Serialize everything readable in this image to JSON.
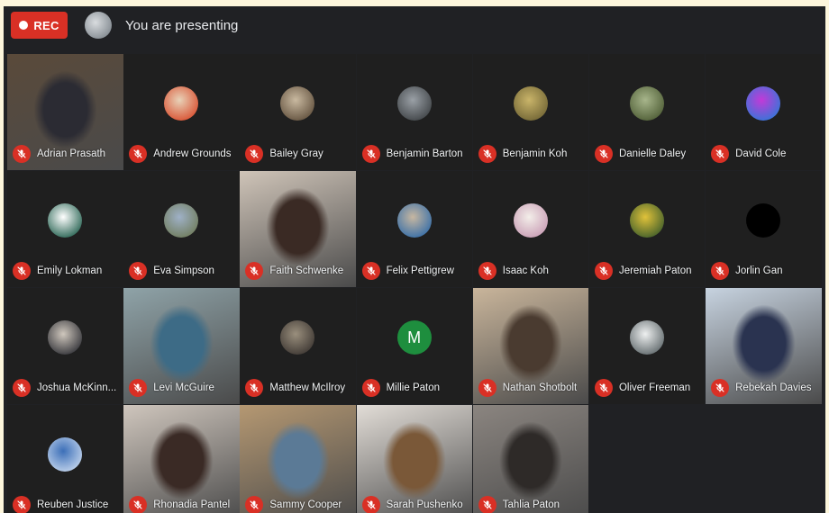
{
  "topbar": {
    "rec_label": "REC",
    "presenting_text": "You are presenting"
  },
  "participants": [
    {
      "name": "Adrian Prasath",
      "video": true,
      "muted": true,
      "avatar_colors": [
        "#5a4a3a",
        "#2b2b33"
      ]
    },
    {
      "name": "Andrew Grounds",
      "video": false,
      "muted": true,
      "avatar_colors": [
        "#e8d2b8",
        "#d84a2a"
      ]
    },
    {
      "name": "Bailey Gray",
      "video": false,
      "muted": true,
      "avatar_colors": [
        "#c9b9a0",
        "#5e4d3a"
      ]
    },
    {
      "name": "Benjamin Barton",
      "video": false,
      "muted": true,
      "avatar_colors": [
        "#9aa0a6",
        "#3c4043"
      ]
    },
    {
      "name": "Benjamin Koh",
      "video": false,
      "muted": true,
      "avatar_colors": [
        "#c9b469",
        "#6e6233"
      ]
    },
    {
      "name": "Danielle Daley",
      "video": false,
      "muted": true,
      "avatar_colors": [
        "#a7b58b",
        "#4b5a32"
      ]
    },
    {
      "name": "David Cole",
      "video": false,
      "muted": true,
      "avatar_colors": [
        "#c23ad8",
        "#2c7ad8"
      ]
    },
    {
      "name": "Emily Lokman",
      "video": false,
      "muted": true,
      "avatar_colors": [
        "#ffffff",
        "#1d5c4a"
      ]
    },
    {
      "name": "Eva Simpson",
      "video": false,
      "muted": true,
      "avatar_colors": [
        "#9fb1c7",
        "#6e7a58"
      ]
    },
    {
      "name": "Faith Schwenke",
      "video": true,
      "muted": true,
      "avatar_colors": [
        "#cfc4b8",
        "#3a2a24"
      ]
    },
    {
      "name": "Felix Pettigrew",
      "video": false,
      "muted": true,
      "avatar_colors": [
        "#c7b7a1",
        "#2f6aa8"
      ]
    },
    {
      "name": "Isaac Koh",
      "video": false,
      "muted": true,
      "avatar_colors": [
        "#f3eee9",
        "#c79ab3"
      ]
    },
    {
      "name": "Jeremiah Paton",
      "video": false,
      "muted": true,
      "avatar_colors": [
        "#e0c23a",
        "#3a5a2a"
      ]
    },
    {
      "name": "Jorlin Gan",
      "video": false,
      "muted": true,
      "avatar_colors": [
        "#000000",
        "#000000"
      ]
    },
    {
      "name": "Joshua McKinn...",
      "video": false,
      "muted": true,
      "avatar_colors": [
        "#cfc7bd",
        "#2c2d33"
      ]
    },
    {
      "name": "Levi McGuire",
      "video": true,
      "muted": true,
      "avatar_colors": [
        "#8fa3a8",
        "#3d6b86"
      ]
    },
    {
      "name": "Matthew McIlroy",
      "video": false,
      "muted": true,
      "avatar_colors": [
        "#9a8f7d",
        "#3a3430"
      ]
    },
    {
      "name": "Millie Paton",
      "video": false,
      "muted": true,
      "letter": "M",
      "avatar_colors": [
        "#1e8e3e",
        "#1e8e3e"
      ]
    },
    {
      "name": "Nathan Shotbolt",
      "video": true,
      "muted": true,
      "avatar_colors": [
        "#c9b59b",
        "#4a3b30"
      ]
    },
    {
      "name": "Oliver Freeman",
      "video": false,
      "muted": true,
      "avatar_colors": [
        "#eef0f0",
        "#5a6366"
      ]
    },
    {
      "name": "Rebekah Davies",
      "video": true,
      "muted": true,
      "avatar_colors": [
        "#c7d3e0",
        "#2a3350"
      ]
    },
    {
      "name": "Reuben Justice",
      "video": false,
      "muted": true,
      "avatar_colors": [
        "#3c6fb8",
        "#c9d9ef"
      ]
    },
    {
      "name": "Rhonadia Pantel",
      "video": true,
      "muted": true,
      "avatar_colors": [
        "#cfc6bd",
        "#3a2a25"
      ]
    },
    {
      "name": "Sammy Cooper",
      "video": true,
      "muted": true,
      "avatar_colors": [
        "#b59872",
        "#5b7a96"
      ]
    },
    {
      "name": "Sarah Pushenko",
      "video": true,
      "muted": true,
      "avatar_colors": [
        "#e2ddd7",
        "#7a5838"
      ]
    },
    {
      "name": "Tahlia Paton",
      "video": true,
      "muted": true,
      "avatar_colors": [
        "#8b8580",
        "#2e2a28"
      ]
    }
  ],
  "colors": {
    "rec_red": "#d93025",
    "mic_red": "#d93025",
    "tile_bg": "#1f1f1f",
    "window_bg": "#202124",
    "letter_avatar": "#1e8e3e"
  }
}
